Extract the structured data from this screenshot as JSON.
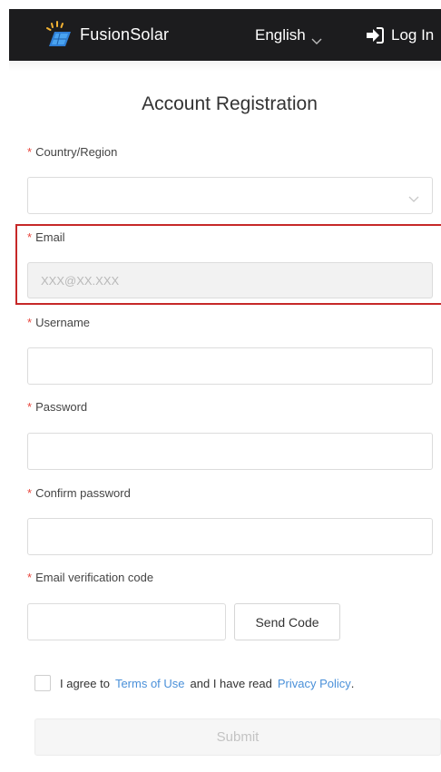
{
  "header": {
    "app_name": "FusionSolar",
    "language": "English",
    "login_label": "Log In"
  },
  "title": "Account Registration",
  "form": {
    "country": {
      "label": "Country/Region",
      "value": ""
    },
    "email": {
      "label": "Email",
      "placeholder": "XXX@XX.XXX",
      "value": ""
    },
    "username": {
      "label": "Username",
      "value": ""
    },
    "password": {
      "label": "Password",
      "value": ""
    },
    "confirm_password": {
      "label": "Confirm password",
      "value": ""
    },
    "verification_code": {
      "label": "Email verification code",
      "value": ""
    },
    "send_code_label": "Send Code",
    "agree": {
      "prefix": "I agree to",
      "terms_link": "Terms of Use",
      "middle": "and I have read",
      "privacy_link": "Privacy Policy",
      "suffix": "."
    },
    "submit_label": "Submit"
  },
  "required_marker": "*",
  "colors": {
    "header_bg": "#1c1c1e",
    "required": "#e8453c",
    "link": "#4a90d9",
    "highlight": "#c62828"
  }
}
